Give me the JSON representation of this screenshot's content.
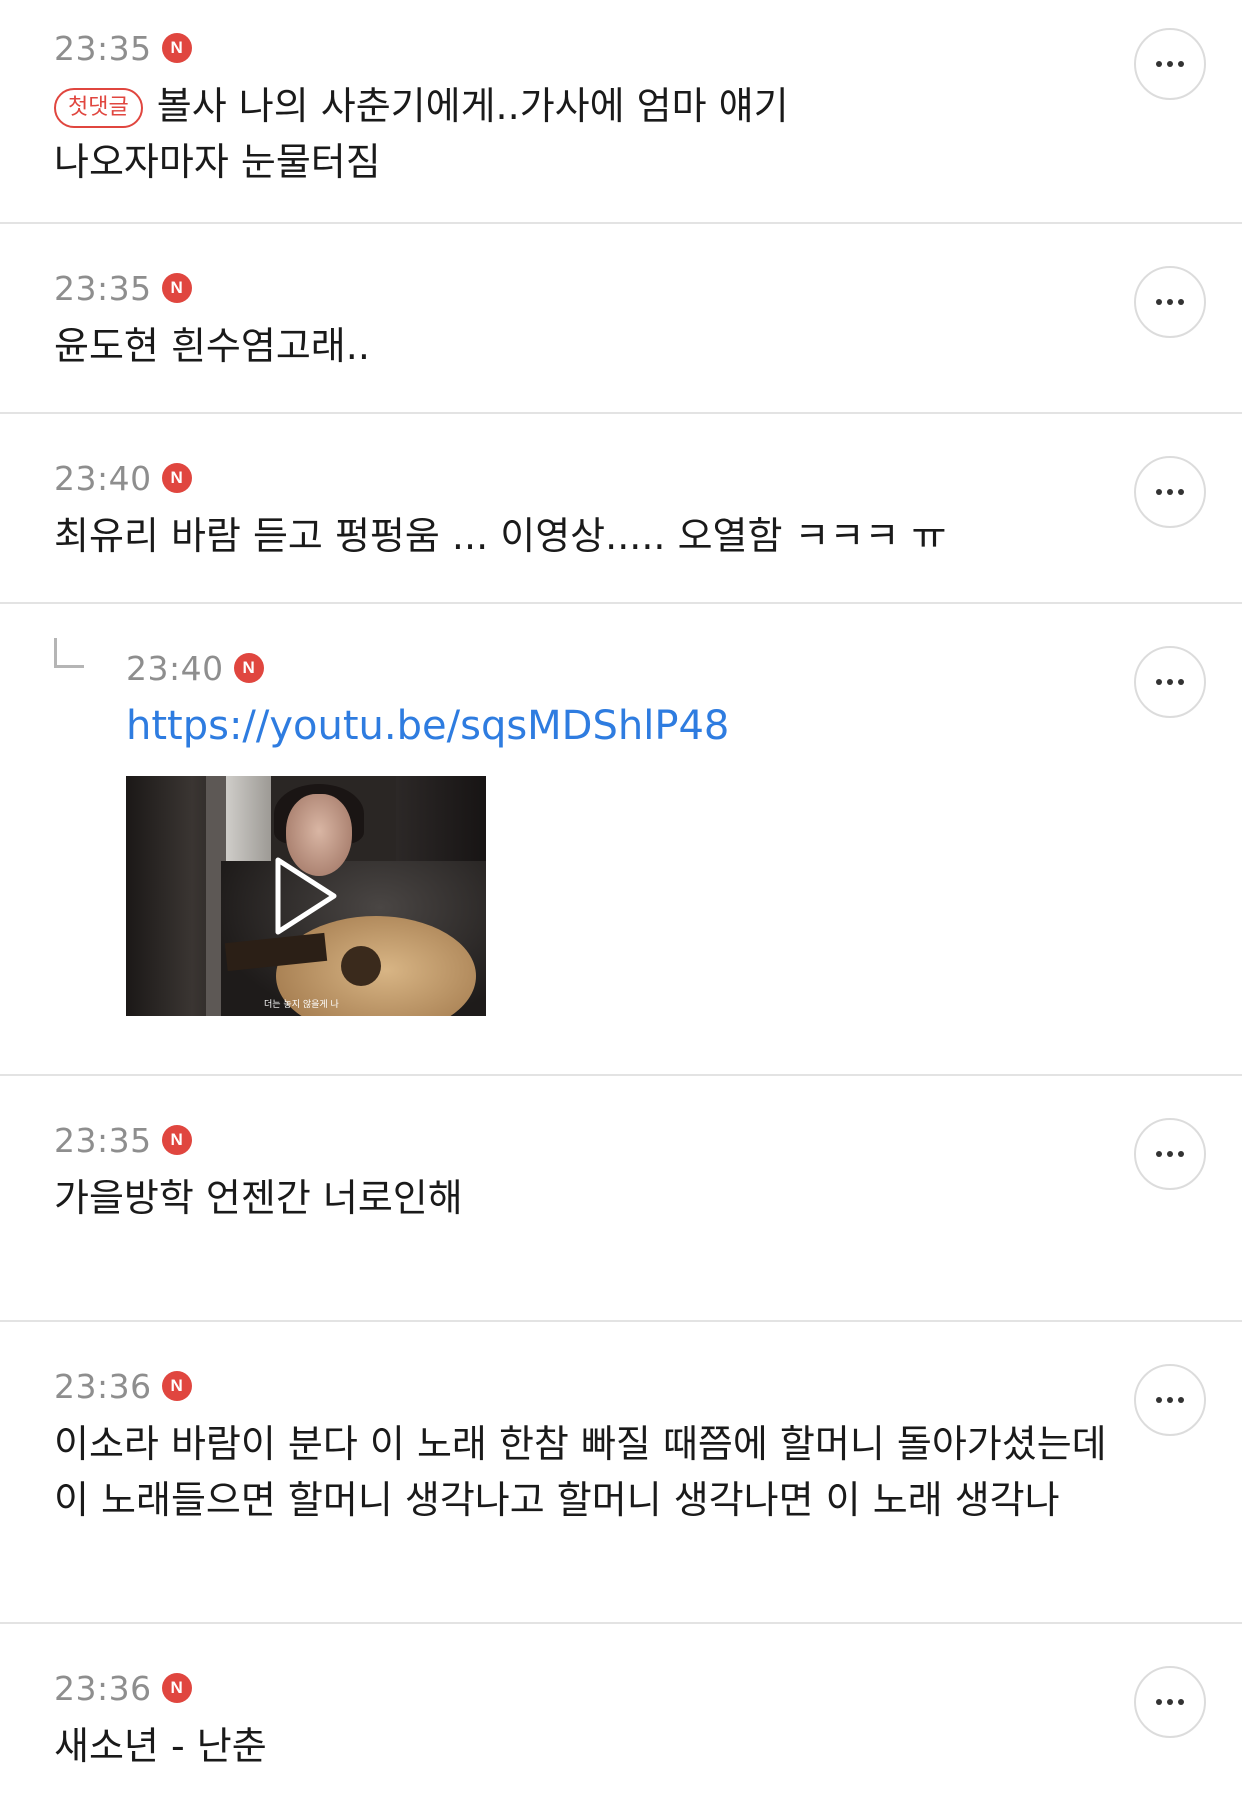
{
  "comments": [
    {
      "time": "23:35",
      "new_badge": "N",
      "first_badge": "첫댓글",
      "text": "볼사 나의 사춘기에게..가사에 엄마 얘기 나오자마자 눈물터짐"
    },
    {
      "time": "23:35",
      "new_badge": "N",
      "text": "윤도현 흰수염고래.."
    },
    {
      "time": "23:40",
      "new_badge": "N",
      "text": "최유리 바람 듣고 펑펑움 ... 이영상..... 오열함 ㅋㅋㅋ ㅠ"
    },
    {
      "time": "23:40",
      "new_badge": "N",
      "link": "https://youtu.be/sqsMDShlP48",
      "video_caption": "더는 놓지 않을게 나"
    },
    {
      "time": "23:35",
      "new_badge": "N",
      "text": "가을방학 언젠간 너로인해"
    },
    {
      "time": "23:36",
      "new_badge": "N",
      "text": "이소라 바람이 분다 이 노래 한참 빠질 때쯤에 할머니 돌아가셨는데 이 노래들으면 할머니 생각나고 할머니 생각나면 이 노래 생각나"
    },
    {
      "time": "23:36",
      "new_badge": "N",
      "text": "새소년 - 난춘"
    }
  ],
  "colors": {
    "accent_red": "#e0463f",
    "link_blue": "#2e7ce0",
    "time_gray": "#8e8e8e",
    "divider": "#e3e3e3"
  },
  "icons": {
    "more": "more-dots-icon",
    "reply": "reply-arrow-icon",
    "play": "play-icon"
  }
}
